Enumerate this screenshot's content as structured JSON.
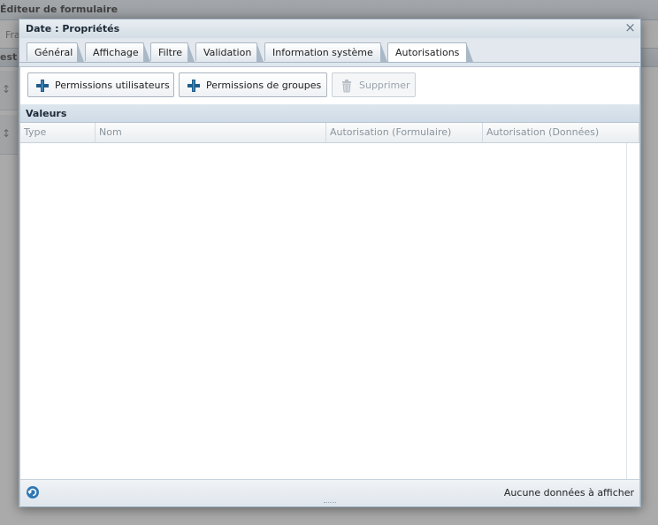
{
  "background": {
    "title": "Éditeur de formulaire",
    "toolbar_text": "Fra",
    "strip_text": "est",
    "row_handle": "↕"
  },
  "dialog": {
    "title": "Date : Propriétés",
    "close_label": "×"
  },
  "tabs": [
    {
      "label": "Général",
      "active": false
    },
    {
      "label": "Affichage",
      "active": false
    },
    {
      "label": "Filtre",
      "active": false
    },
    {
      "label": "Validation",
      "active": false
    },
    {
      "label": "Information système",
      "active": false
    },
    {
      "label": "Autorisations",
      "active": true
    }
  ],
  "toolbar": {
    "user_permissions": "Permissions utilisateurs",
    "group_permissions": "Permissions de groupes",
    "delete": "Supprimer"
  },
  "grid": {
    "title": "Valeurs",
    "columns": [
      "Type",
      "Nom",
      "Autorisation (Formulaire)",
      "Autorisation (Données)"
    ],
    "rows": []
  },
  "footer": {
    "empty_message": "Aucune données à afficher"
  },
  "colors": {
    "accent": "#1d5d8c",
    "header_bg": "#d4dde5"
  }
}
